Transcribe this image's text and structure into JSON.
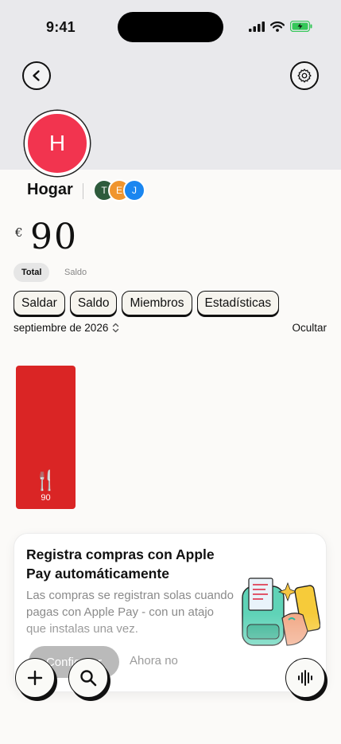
{
  "status_bar": {
    "time": "9:41"
  },
  "group": {
    "avatar_letter": "H",
    "name": "Hogar",
    "members": [
      {
        "initial": "T",
        "color": "#2E5B3C"
      },
      {
        "initial": "E",
        "color": "#F0952E"
      },
      {
        "initial": "J",
        "color": "#1A86F0"
      }
    ]
  },
  "balance": {
    "currency": "€",
    "amount": "90"
  },
  "toggle": {
    "total": "Total",
    "saldo": "Saldo"
  },
  "actions": {
    "saldar": "Saldar",
    "saldo": "Saldo",
    "miembros": "Miembros",
    "estadisticas": "Estadísticas"
  },
  "period": {
    "month": "septiembre de 2026",
    "hide": "Ocultar"
  },
  "chart_data": {
    "type": "bar",
    "categories": [
      "🍴"
    ],
    "values": [
      90
    ],
    "bar_color": "#DA2525",
    "ylim": [
      0,
      90
    ]
  },
  "promo": {
    "title": "Registra compras con Apple Pay automáticamente",
    "body": "Las compras se registran solas cuando pagas con Apple Pay - con un atajo que instalas una vez.",
    "primary": "Configurar",
    "secondary": "Ahora no"
  },
  "icons": {
    "back": "chevron-left-icon",
    "settings": "gear-icon",
    "add": "plus-icon",
    "search": "search-icon",
    "voice": "waveform-icon"
  }
}
